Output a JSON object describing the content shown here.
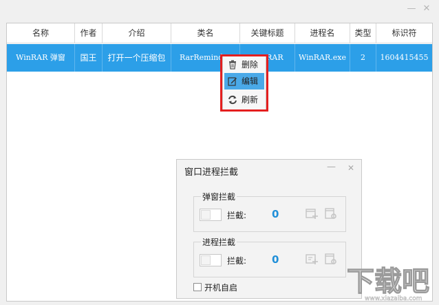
{
  "window": {
    "minimize_glyph": "—",
    "close_glyph": "✕"
  },
  "table": {
    "columns": [
      "名称",
      "作者",
      "介绍",
      "类名",
      "关键标题",
      "进程名",
      "类型",
      "标识符"
    ],
    "rows": [
      [
        "WinRAR 弹窗",
        "国王",
        "打开一个压缩包",
        "RarReminder",
        "WinRAR",
        "WinRAR.exe",
        "2",
        "1604415455"
      ]
    ]
  },
  "context_menu": {
    "items": [
      {
        "label": "删除",
        "icon": "trash-icon"
      },
      {
        "label": "编辑",
        "icon": "edit-icon"
      },
      {
        "label": "刷新",
        "icon": "refresh-icon"
      }
    ]
  },
  "dialog": {
    "title": "窗口进程拦截",
    "min_glyph": "—",
    "close_glyph": "✕",
    "popup_group": {
      "title": "弹窗拦截",
      "label": "拦截:",
      "count": "0"
    },
    "process_group": {
      "title": "进程拦截",
      "label": "拦截:",
      "count": "0"
    },
    "autostart_label": "开机自启"
  },
  "watermark": {
    "text": "下载吧",
    "url": "www.xiazaiba.com"
  },
  "colors": {
    "selected_row": "#2c9fe8",
    "accent": "#1f8fd8",
    "highlight_border": "#e41e1e"
  }
}
